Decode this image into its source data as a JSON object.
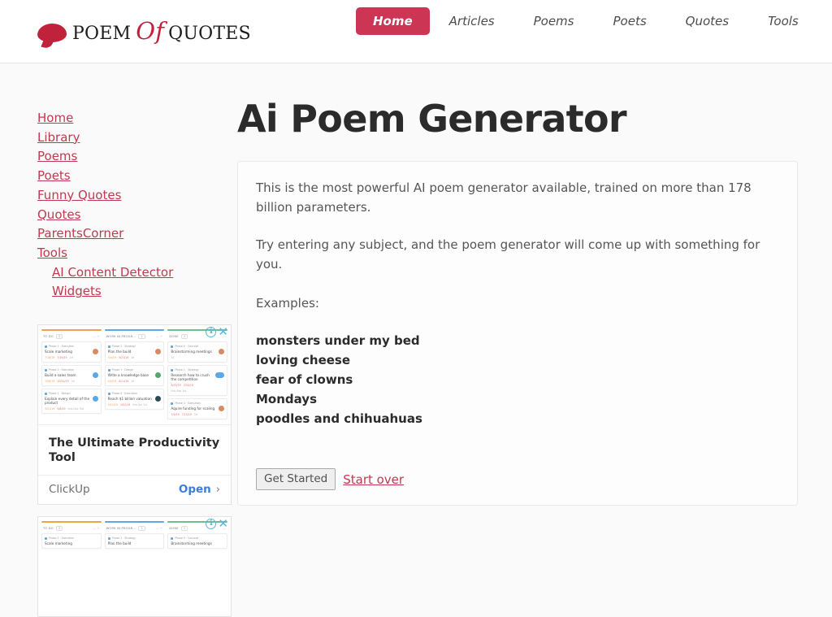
{
  "header": {
    "logo": {
      "word1": "Poem",
      "word_of": "Of",
      "word2": "Quotes",
      "bubble_color": "#c0223c",
      "icon": "speech-bubble-icon"
    },
    "nav": [
      {
        "label": "Home",
        "active": true
      },
      {
        "label": "Articles",
        "active": false
      },
      {
        "label": "Poems",
        "active": false
      },
      {
        "label": "Poets",
        "active": false
      },
      {
        "label": "Quotes",
        "active": false
      },
      {
        "label": "Tools",
        "active": false
      }
    ],
    "active_color": "#cc3553"
  },
  "sidebar": {
    "links": [
      {
        "label": "Home",
        "sub": false
      },
      {
        "label": "Library",
        "sub": false
      },
      {
        "label": "Poems",
        "sub": false
      },
      {
        "label": "Poets",
        "sub": false
      },
      {
        "label": "Funny Quotes",
        "sub": false
      },
      {
        "label": "Quotes",
        "sub": false
      },
      {
        "label": "ParentsCorner",
        "sub": false
      },
      {
        "label": "Tools",
        "sub": false
      },
      {
        "label": "AI Content Detector",
        "sub": true
      },
      {
        "label": "Widgets",
        "sub": true
      }
    ],
    "link_color": "#c0394f",
    "ads": [
      {
        "headline": "The Ultimate Productivity Tool",
        "advertiser": "ClickUp",
        "cta": "Open",
        "cta_chevron": "›",
        "adchoices_icon": "info-icon",
        "close_icon": "close-icon",
        "creative": {
          "type": "kanban-board-screenshot",
          "columns": [
            {
              "title": "TO DO",
              "count": "3",
              "cards": [
                {
                  "tag": "Phase 2 · Execution",
                  "title": "Scale marketing",
                  "date1": "7/18/19",
                  "date2": "7/19/19",
                  "meta": "2d",
                  "avatar": "orange"
                },
                {
                  "tag": "Phase 2 · Execution",
                  "title": "Build a sales team",
                  "date1": "10/8/19",
                  "date2": "10/24/19",
                  "meta": "2d",
                  "avatar": "blue"
                },
                {
                  "tag": "Phase 1 · Design",
                  "title": "Explain every detail of the product",
                  "date1": "3/21/19",
                  "date2": "4/8/19",
                  "meta": "this Dec 3rd",
                  "avatar": "blue"
                }
              ]
            },
            {
              "title": "WORK IN PROGR...",
              "count": "3",
              "cards": [
                {
                  "tag": "Phase 2 · Strategy",
                  "title": "Plan the build",
                  "date1": "3/4/19",
                  "date2": "3/21/19",
                  "meta": "4d",
                  "avatar": "orange"
                },
                {
                  "tag": "Phase 1 · Design",
                  "title": "Write a knowledge base",
                  "date1": "4/4/19",
                  "date2": "4/11/19",
                  "meta": "1d",
                  "avatar": "green"
                },
                {
                  "tag": "Phase 4 · Execution",
                  "title": "Reach $1 billion valuation",
                  "date1": "4/14/19",
                  "date2": "10/2/19",
                  "meta": "this Jan 1st",
                  "avatar": "dark"
                }
              ]
            },
            {
              "title": "DONE",
              "count": "3",
              "cards": [
                {
                  "tag": "Phase 0 · Concept",
                  "title": "Brainstorming meetings",
                  "date1": "",
                  "date2": "",
                  "meta": "1d",
                  "avatar": "orange"
                },
                {
                  "tag": "Phase 1 · Strategy",
                  "title": "Research how to crush the competition",
                  "date1": "9/25/19",
                  "date2": "3/30/19",
                  "meta": "this Sep 1st",
                  "avatar": "pair"
                },
                {
                  "tag": "Phase 4 · Execution",
                  "title": "Aquire funding for scaling",
                  "date1": "7/9/19",
                  "date2": "7/15/19",
                  "meta": "2d",
                  "avatar": "orange"
                }
              ]
            }
          ]
        }
      },
      {
        "headline": "",
        "advertiser": "",
        "cta": "",
        "cta_chevron": "›",
        "adchoices_icon": "info-icon",
        "close_icon": "close-icon",
        "creative": {
          "type": "kanban-board-screenshot",
          "columns": [
            {
              "title": "TO DO",
              "count": "3",
              "cards": [
                {
                  "tag": "Phase 2 · Execution",
                  "title": "Scale marketing",
                  "date1": "7/18/19",
                  "date2": "7/19/19",
                  "meta": "2d",
                  "avatar": "orange"
                }
              ]
            },
            {
              "title": "WORK IN PROGR...",
              "count": "3",
              "cards": [
                {
                  "tag": "Phase 2 · Strategy",
                  "title": "Plan the build",
                  "date1": "3/4/19",
                  "date2": "3/21/19",
                  "meta": "4d",
                  "avatar": "orange"
                }
              ]
            },
            {
              "title": "DONE",
              "count": "3",
              "cards": [
                {
                  "tag": "Phase 0 · Concept",
                  "title": "Brainstorming meetings",
                  "date1": "",
                  "date2": "",
                  "meta": "1d",
                  "avatar": "orange"
                }
              ]
            }
          ]
        }
      }
    ]
  },
  "main": {
    "title": "Ai Poem Generator",
    "intro_paragraph": "This is the most powerful AI poem generator available, trained on more than 178 billion parameters.",
    "instruction_paragraph": "Try entering any subject, and the poem generator will come up with something for you.",
    "examples_label": "Examples:",
    "examples": [
      "monsters under my bed",
      "loving cheese",
      "fear of clowns",
      "Mondays",
      "poodles and chihuahuas"
    ],
    "get_started_label": "Get Started",
    "start_over_label": "Start over"
  }
}
